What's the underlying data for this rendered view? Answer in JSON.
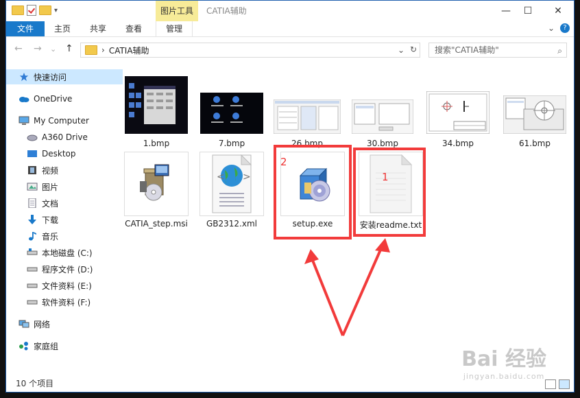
{
  "window": {
    "title": "CATIA辅助",
    "context_tab": "图片工具",
    "controls": {
      "minimize": "—",
      "maximize": "☐",
      "close": "✕"
    }
  },
  "ribbon": {
    "tabs": [
      {
        "label": "文件"
      },
      {
        "label": "主页"
      },
      {
        "label": "共享"
      },
      {
        "label": "查看"
      },
      {
        "label": "管理"
      }
    ],
    "expand": "⌄",
    "help": "?"
  },
  "address": {
    "back": "←",
    "forward": "→",
    "recent": "⌄",
    "up": "↑",
    "chevron": "›",
    "path": "CATIA辅助",
    "drop": "⌄",
    "refresh": "↻",
    "search_placeholder": "搜索\"CATIA辅助\"",
    "search_icon": "⌕"
  },
  "sidebar": {
    "items": [
      {
        "label": "快速访问",
        "icon": "star-icon"
      },
      {
        "label": "OneDrive",
        "icon": "cloud-icon"
      },
      {
        "label": "My Computer",
        "icon": "computer-icon"
      },
      {
        "label": "A360 Drive",
        "icon": "drive-icon"
      },
      {
        "label": "Desktop",
        "icon": "desktop-icon"
      },
      {
        "label": "视频",
        "icon": "video-icon"
      },
      {
        "label": "图片",
        "icon": "picture-icon"
      },
      {
        "label": "文档",
        "icon": "document-icon"
      },
      {
        "label": "下载",
        "icon": "download-icon"
      },
      {
        "label": "音乐",
        "icon": "music-icon"
      },
      {
        "label": "本地磁盘 (C:)",
        "icon": "disk-icon"
      },
      {
        "label": "程序文件 (D:)",
        "icon": "disk-icon"
      },
      {
        "label": "文件资料 (E:)",
        "icon": "disk-icon"
      },
      {
        "label": "软件资料 (F:)",
        "icon": "disk-icon"
      },
      {
        "label": "网络",
        "icon": "network-icon"
      },
      {
        "label": "家庭组",
        "icon": "homegroup-icon"
      }
    ]
  },
  "files": [
    {
      "name": "1.bmp",
      "kind": "dark-screenshot"
    },
    {
      "name": "7.bmp",
      "kind": "dark-desktop"
    },
    {
      "name": "26.bmp",
      "kind": "light-dialog"
    },
    {
      "name": "30.bmp",
      "kind": "light-dialog"
    },
    {
      "name": "34.bmp",
      "kind": "drawing"
    },
    {
      "name": "61.bmp",
      "kind": "light-dialog"
    },
    {
      "name": "CATIA_step.msi",
      "kind": "installer"
    },
    {
      "name": "GB2312.xml",
      "kind": "xml"
    },
    {
      "name": "setup.exe",
      "kind": "setup"
    },
    {
      "name": "安装readme.txt",
      "kind": "text"
    }
  ],
  "annotations": {
    "box_1": "1",
    "box_2": "2"
  },
  "status": {
    "count": "10 个项目"
  },
  "watermark": {
    "brand": "Bai 经验",
    "url": "jingyan.baidu.com"
  },
  "colors": {
    "accent": "#1979ca",
    "context_tab": "#f7eb98",
    "selected": "#cce8ff",
    "annotation": "#f23b3b"
  }
}
